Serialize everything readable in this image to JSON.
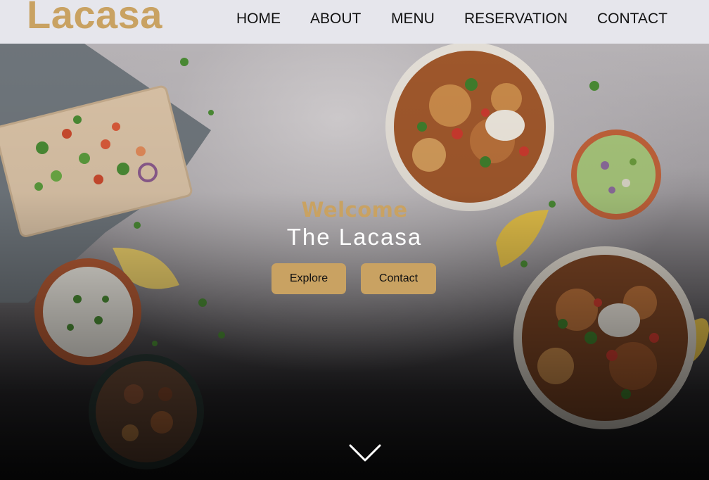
{
  "brand": {
    "logo": "Lacasa",
    "accent_color": "#c9a262"
  },
  "nav": {
    "items": [
      {
        "label": "HOME"
      },
      {
        "label": "ABOUT"
      },
      {
        "label": "MENU"
      },
      {
        "label": "RESERVATION"
      },
      {
        "label": "CONTACT"
      }
    ]
  },
  "hero": {
    "welcome": "Welcome",
    "title": "The Lacasa",
    "buttons": {
      "explore": "Explore",
      "contact": "Contact"
    },
    "scroll_icon": "chevron-down-icon"
  }
}
